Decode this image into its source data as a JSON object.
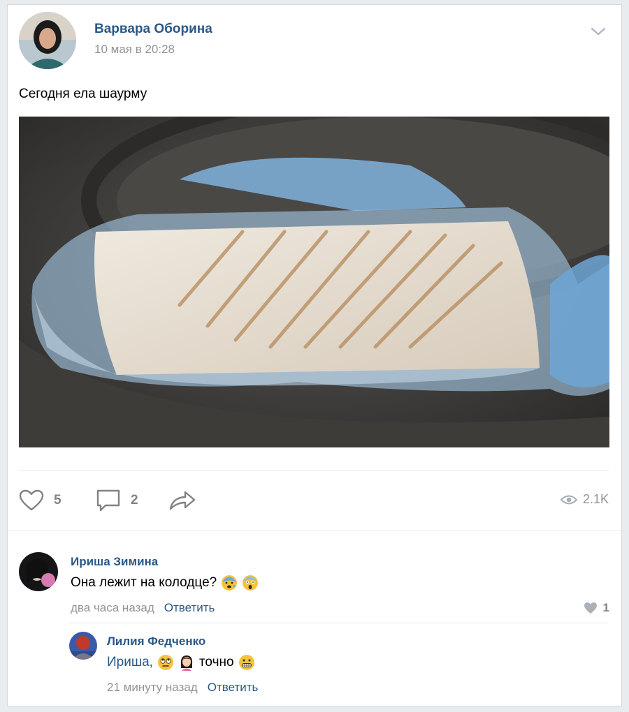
{
  "post": {
    "author": "Варвара Оборина",
    "date": "10 мая в 20:28",
    "text": "Сегодня ела шаурму",
    "image_alt": "shawarma wrapped in a plastic bag lying on a manhole cover"
  },
  "actions": {
    "likes": "5",
    "comments": "2",
    "views": "2.1K"
  },
  "comments": [
    {
      "author": "Ириша Зимина",
      "text": "Она лежит на колодце?",
      "emojis": [
        "anxious-face-emoji",
        "screaming-face-emoji"
      ],
      "time": "два часа назад",
      "reply_label": "Ответить",
      "likes": "1"
    }
  ],
  "reply": {
    "author": "Лилия Федченко",
    "mention": "Ириша,",
    "text": "точно",
    "emojis": [
      "rolling-eyes-emoji",
      "woman-emoji",
      "grimacing-face-emoji"
    ],
    "time": "21 минуту назад",
    "reply_label": "Ответить"
  },
  "colors": {
    "link": "#2a5885",
    "meta": "#939393",
    "icon": "#828282"
  }
}
